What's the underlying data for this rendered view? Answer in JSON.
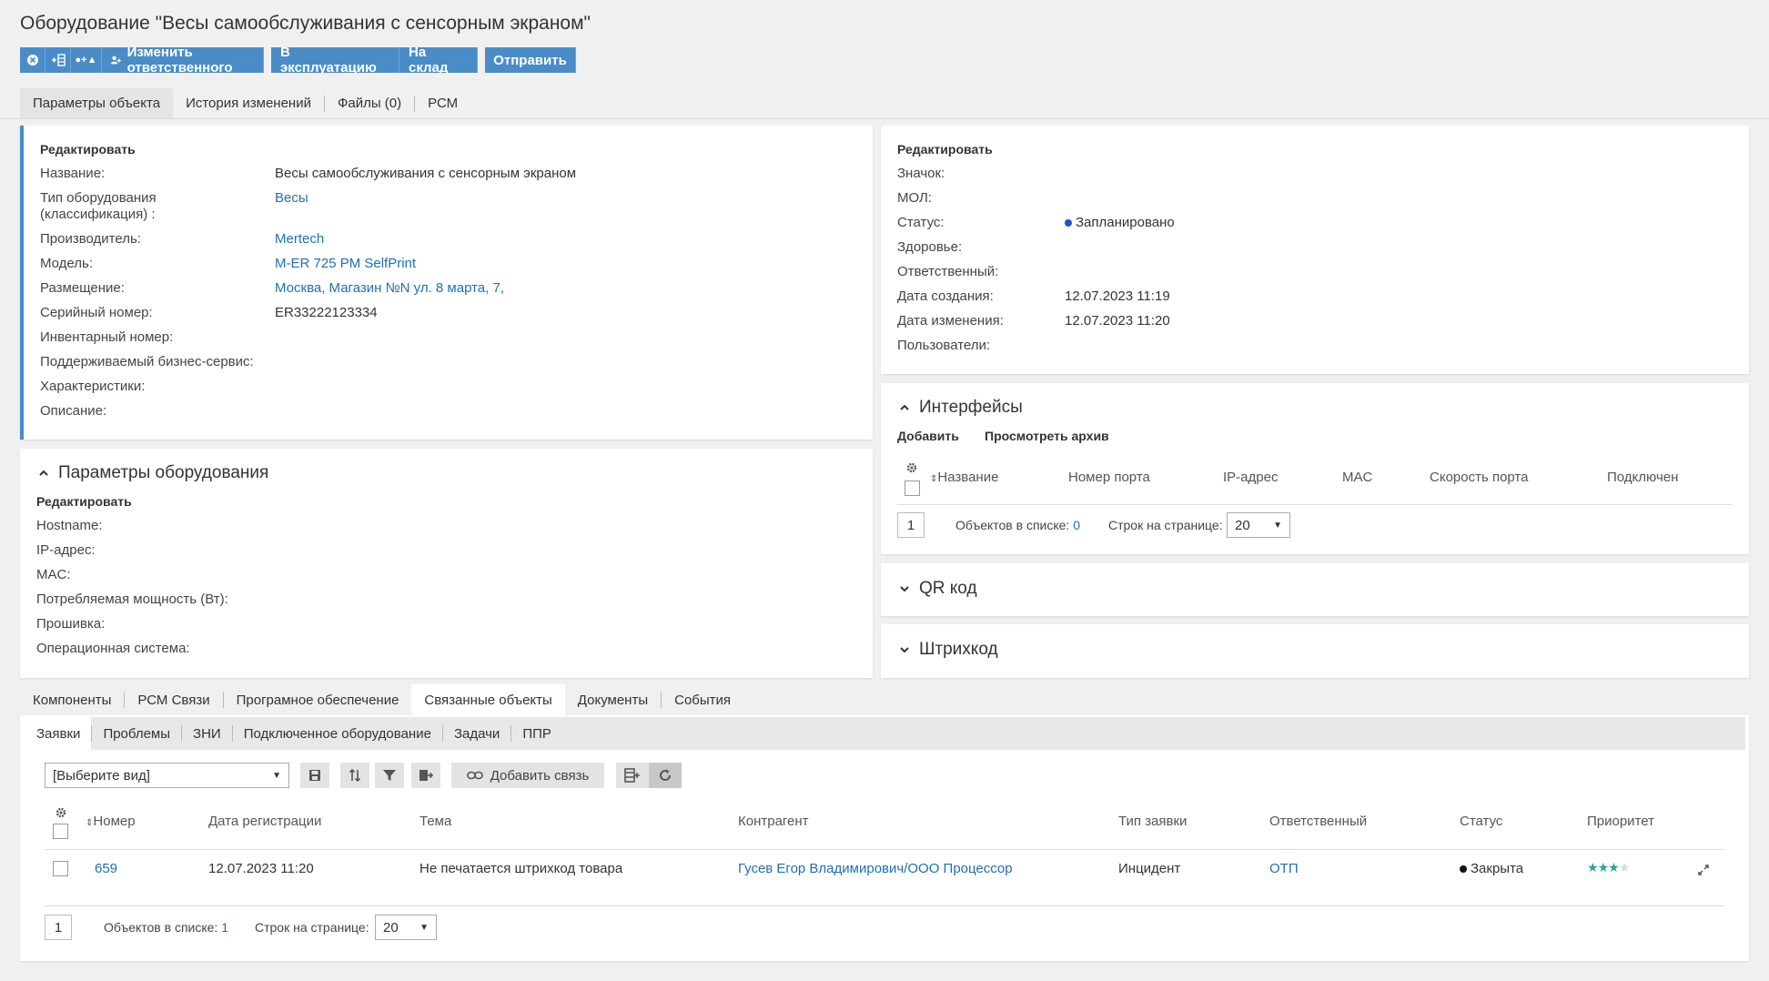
{
  "page_title": "Оборудование \"Весы самообслуживания с сенсорным экраном\"",
  "toolbar": {
    "change_resp": "Изменить ответственного",
    "to_operation": "В эксплуатацию",
    "to_warehouse": "На склад",
    "send": "Отправить"
  },
  "tabs": [
    "Параметры объекта",
    "История изменений",
    "Файлы (0)",
    "РСМ"
  ],
  "object": {
    "edit": "Редактировать",
    "labels": {
      "name": "Название:",
      "type": "Тип оборудования",
      "type2": "(классификация) :",
      "manufacturer": "Производитель:",
      "model": "Модель:",
      "location": "Размещение:",
      "serial": "Серийный номер:",
      "inventory": "Инвентарный номер:",
      "service": "Поддерживаемый бизнес-сервис:",
      "specs": "Характеристики:",
      "description": "Описание:"
    },
    "values": {
      "name": "Весы самообслуживания с сенсорным экраном",
      "type": "Весы",
      "manufacturer": "Mertech",
      "model": "M-ER 725 PM SelfPrint",
      "location": "Москва, Магазин №N ул. 8 марта, 7,",
      "serial": "ER33222123334"
    }
  },
  "status_card": {
    "edit": "Редактировать",
    "labels": {
      "badge": "Значок:",
      "mol": "МОЛ:",
      "status": "Статус:",
      "health": "Здоровье:",
      "responsible": "Ответственный:",
      "created": "Дата создания:",
      "modified": "Дата изменения:",
      "users": "Пользователи:"
    },
    "values": {
      "status": "Запланировано",
      "status_color": "#1a56d6",
      "created": "12.07.2023 11:19",
      "modified": "12.07.2023 11:20"
    }
  },
  "equipment_params": {
    "title": "Параметры оборудования",
    "edit": "Редактировать",
    "labels": {
      "hostname": "Hostname:",
      "ip": "IP-адрес:",
      "mac": "MAC:",
      "power": "Потребляемая мощность (Вт):",
      "firmware": "Прошивка:",
      "os": "Операционная система:"
    }
  },
  "interfaces": {
    "title": "Интерфейсы",
    "add": "Добавить",
    "archive": "Просмотреть архив",
    "columns": [
      "Название",
      "Номер порта",
      "IP-адрес",
      "MAC",
      "Скорость порта",
      "Подключен"
    ],
    "page": "1",
    "count_label": "Объектов в списке:",
    "count": "0",
    "rows_label": "Строк на странице:",
    "rows": "20"
  },
  "qr": {
    "title": "QR код"
  },
  "barcode": {
    "title": "Штрихкод"
  },
  "bottom_tabs": [
    "Компоненты",
    "РСМ Связи",
    "Програмное обеспечение",
    "Связанные объекты",
    "Документы",
    "События"
  ],
  "sub_tabs": [
    "Заявки",
    "Проблемы",
    "ЗНИ",
    "Подключенное оборудование",
    "Задачи",
    "ППР"
  ],
  "requests": {
    "view_placeholder": "[Выберите вид]",
    "add_link": "Добавить связь",
    "columns": [
      "Номер",
      "Дата регистрации",
      "Тема",
      "Контрагент",
      "Тип заявки",
      "Ответственный",
      "Статус",
      "Приоритет"
    ],
    "rows": [
      {
        "number": "659",
        "date": "12.07.2023 11:20",
        "subject": "Не печатается штрихкод товара",
        "contractor": "Гусев Егор Владимирович/ООО Процессор",
        "type": "Инцидент",
        "responsible": "ОТП",
        "status": "Закрыта",
        "priority": 3
      }
    ],
    "page": "1",
    "count_label": "Объектов в списке:",
    "count": "1",
    "rows_label": "Строк на странице:",
    "rows_per_page": "20"
  },
  "colors": {
    "accent": "#4a8cc7",
    "link": "#1e6fb8",
    "star": "#2aa3a3"
  }
}
